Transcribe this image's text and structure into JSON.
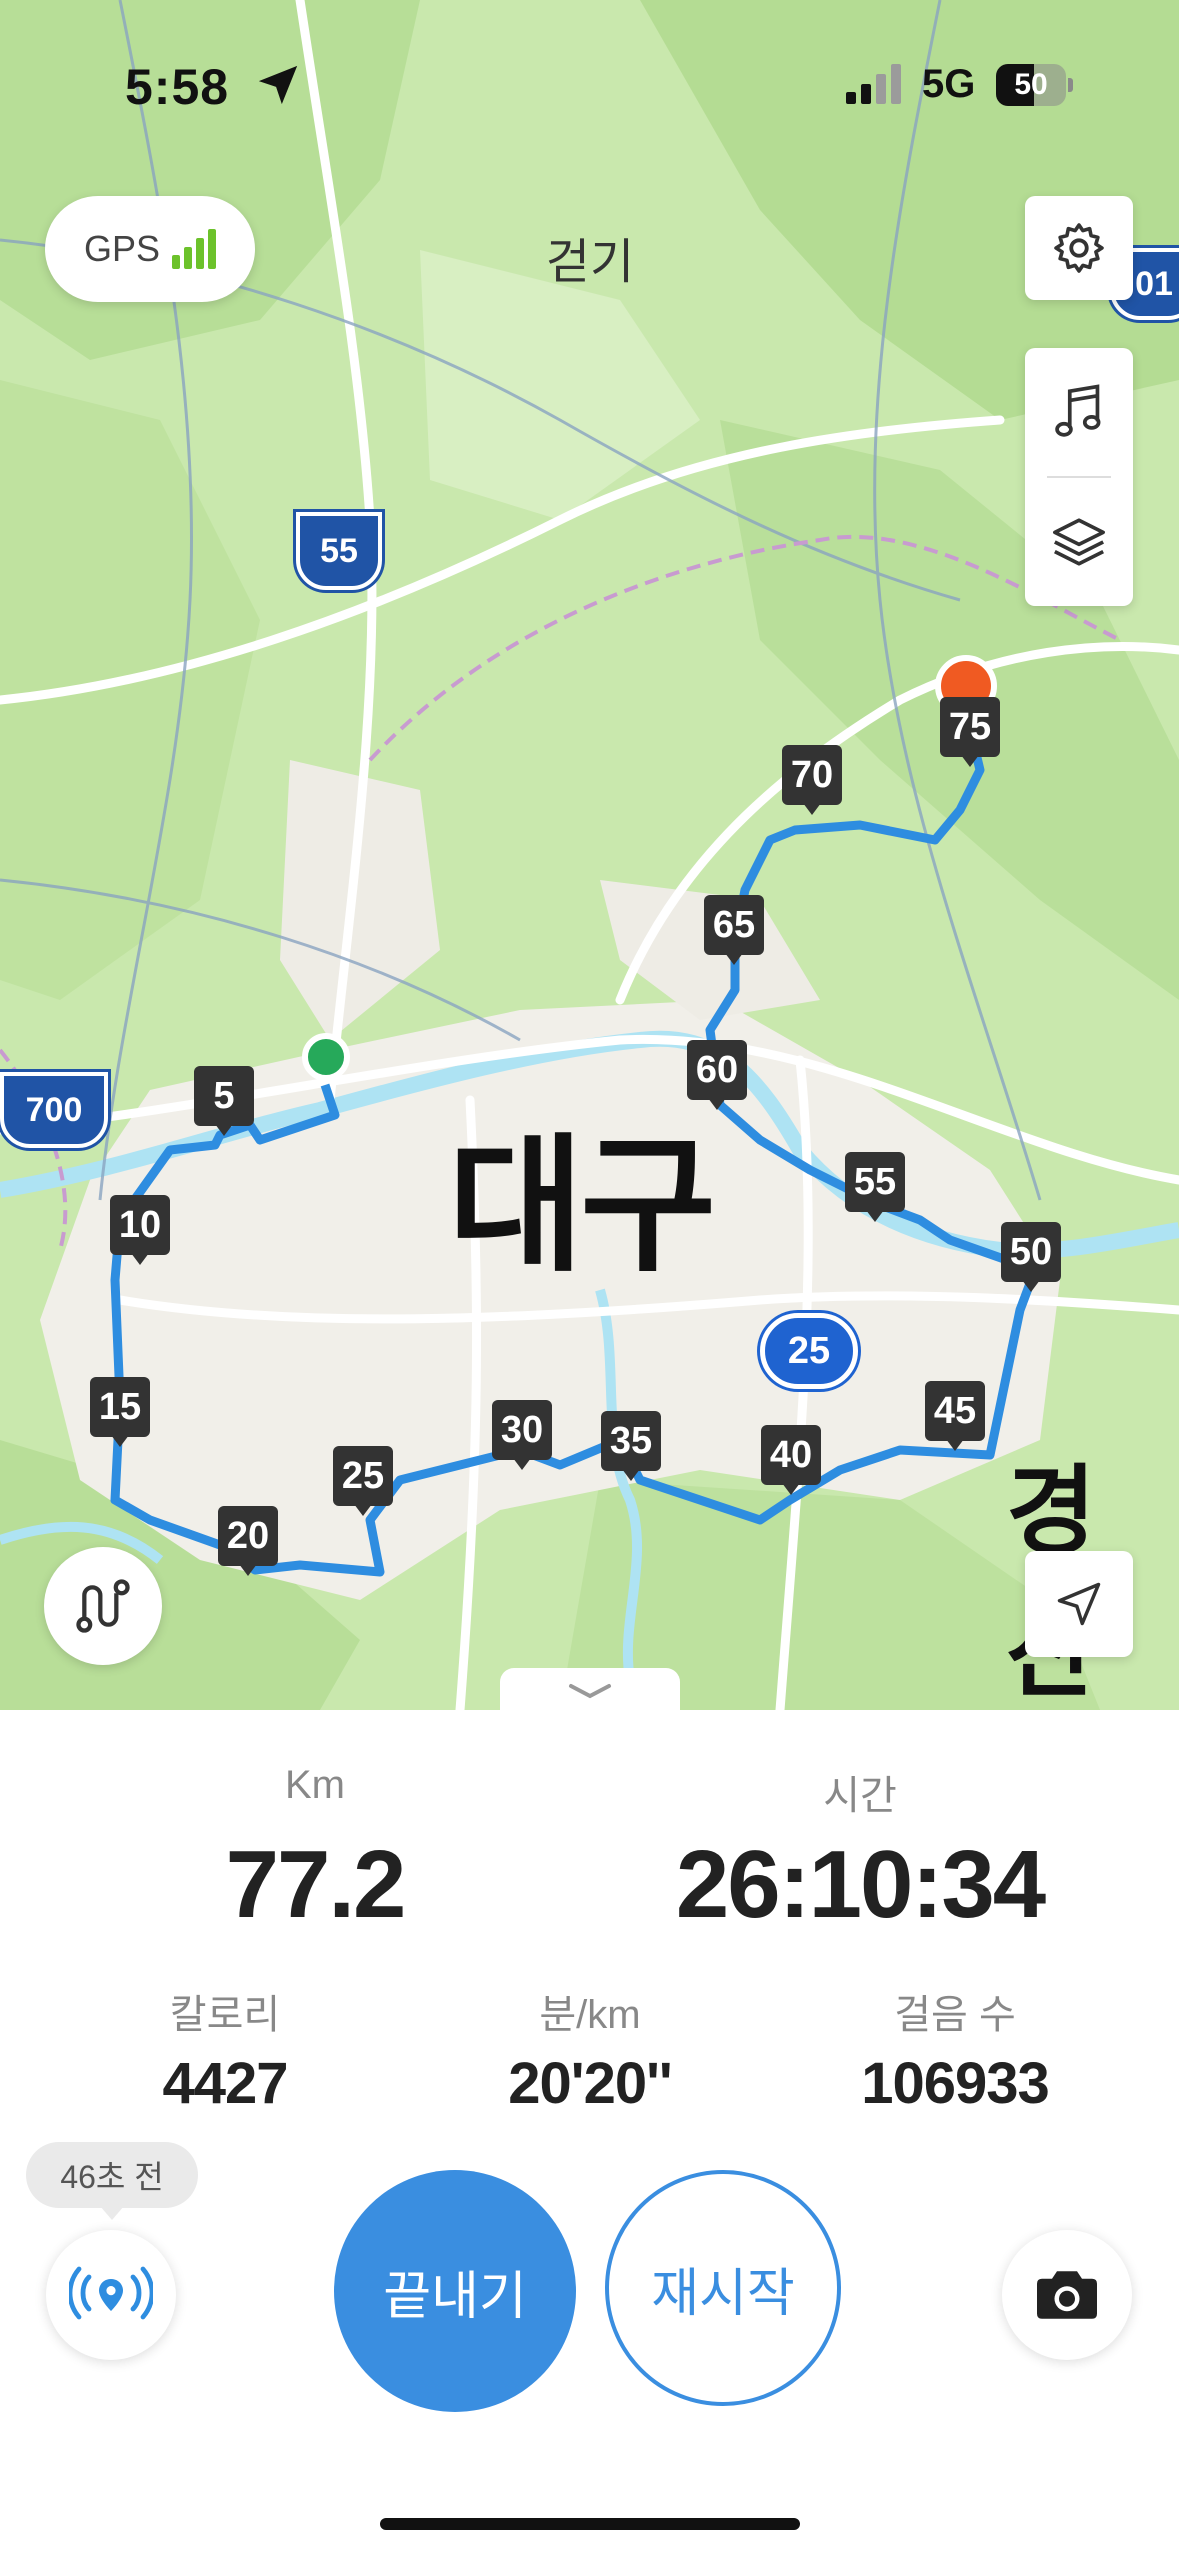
{
  "status_bar": {
    "time": "5:58",
    "network": "5G",
    "battery": "50"
  },
  "header": {
    "gps_label": "GPS",
    "mode_title": "걷기"
  },
  "map": {
    "city_labels": [
      "대구",
      "경산"
    ],
    "road_shields": [
      "55",
      "700",
      "25",
      "01"
    ],
    "markers": [
      "5",
      "10",
      "15",
      "20",
      "25",
      "30",
      "35",
      "40",
      "45",
      "50",
      "55",
      "60",
      "65",
      "70",
      "75"
    ]
  },
  "stats": {
    "distance": {
      "label": "Km",
      "value": "77.2"
    },
    "time": {
      "label": "시간",
      "value": "26:10:34"
    },
    "calories": {
      "label": "칼로리",
      "value": "4427"
    },
    "pace": {
      "label": "분/km",
      "value": "20'20''"
    },
    "steps": {
      "label": "걸음 수",
      "value": "106933"
    }
  },
  "controls": {
    "sync_ago": "46초 전",
    "finish_label": "끝내기",
    "restart_label": "재시작"
  }
}
